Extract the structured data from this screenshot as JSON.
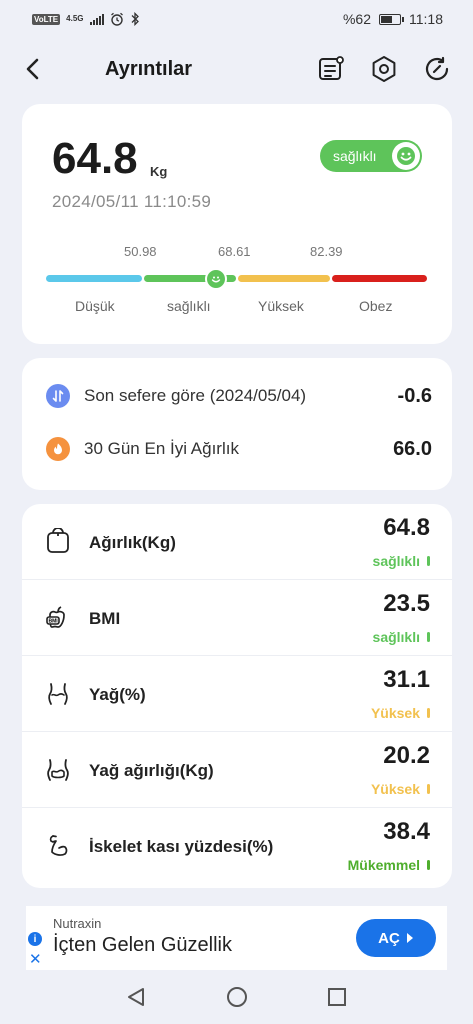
{
  "status_bar": {
    "volte": "VoLTE",
    "network": "4.5G",
    "battery_text": "%62",
    "battery_level": 0.62,
    "time": "11:18"
  },
  "header": {
    "title": "Ayrıntılar",
    "icons": [
      "back-icon",
      "report-icon",
      "settings-icon",
      "refresh-icon"
    ]
  },
  "summary": {
    "weight": "64.8",
    "unit": "Kg",
    "timestamp": "2024/05/11 11:10:59",
    "status": "sağlıklı",
    "thresholds": [
      "50.98",
      "68.61",
      "82.39"
    ],
    "categories": [
      "Düşük",
      "sağlıklı",
      "Yüksek",
      "Obez"
    ],
    "scale_colors": [
      "#5bc8ea",
      "#5ec45a",
      "#f2c14e",
      "#d9201c"
    ]
  },
  "comparison": {
    "items": [
      {
        "label": "Son sefere göre (2024/05/04)",
        "value": "-0.6",
        "icon": "compare-icon",
        "color": "#6b8cf0"
      },
      {
        "label": "30 Gün En İyi Ağırlık",
        "value": "66.0",
        "icon": "fire-icon",
        "color": "#f5923e"
      }
    ]
  },
  "metrics": [
    {
      "label": "Ağırlık(Kg)",
      "value": "64.8",
      "status": "sağlıklı",
      "color": "#5ec45a",
      "icon": "scale-icon"
    },
    {
      "label": "BMI",
      "value": "23.5",
      "status": "sağlıklı",
      "color": "#5ec45a",
      "icon": "bmi-icon"
    },
    {
      "label": "Yağ(%)",
      "value": "31.1",
      "status": "Yüksek",
      "color": "#f2c14e",
      "icon": "body-fat-icon"
    },
    {
      "label": "Yağ ağırlığı(Kg)",
      "value": "20.2",
      "status": "Yüksek",
      "color": "#f2c14e",
      "icon": "fat-weight-icon"
    },
    {
      "label": "İskelet kası yüzdesi(%)",
      "value": "38.4",
      "status": "Mükemmel",
      "color": "#4fae2d",
      "icon": "muscle-icon"
    }
  ],
  "ad": {
    "brand": "Nutraxin",
    "title": "İçten Gelen Güzellik",
    "button": "AÇ"
  }
}
